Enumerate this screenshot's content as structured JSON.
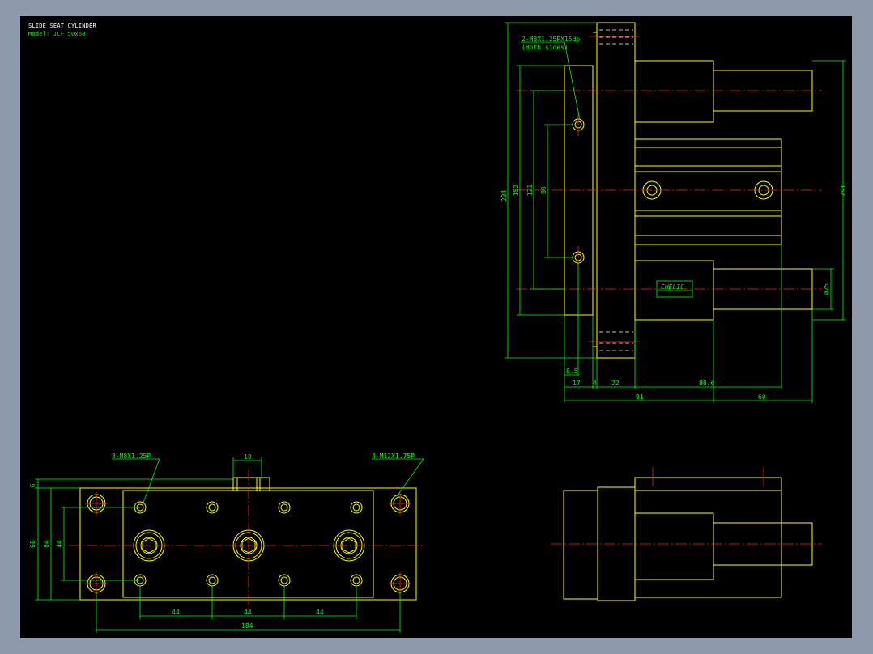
{
  "drawing": {
    "title": "SLIDE SEAT CYLINDER",
    "model": "Model: JCF 50x60",
    "colors": {
      "background": "#000000",
      "frame": "#8e9aab",
      "outline": "#ffff00",
      "dimension": "#00ff00",
      "centerline": "#ff2020",
      "text_title": "#ffffff"
    }
  },
  "side_view": {
    "note_tap": "2-M8X1.25PX15dp",
    "note_tap_sub": "(Both sides)",
    "dim_204": "204",
    "dim_152": "152",
    "dim_121": "121",
    "dim_80": "80",
    "dim_157": "157",
    "dim_dia25": "ø25",
    "dim_8_5": "8.5",
    "dim_17": "17",
    "dim_4": "4",
    "dim_22": "22",
    "dim_88_6": "88.6",
    "dim_91": "91",
    "dim_60": "60",
    "brand": "CHELIC"
  },
  "top_view": {
    "note_m8": "8-M8X1.25P",
    "note_m12": "4-M12X1.75P",
    "dim_19": "19",
    "dim_6": "6",
    "dim_68": "68",
    "dim_84": "84",
    "dim_44_v": "44",
    "dim_44_a": "44",
    "dim_44_b": "44",
    "dim_44_c": "44",
    "dim_184": "184"
  }
}
